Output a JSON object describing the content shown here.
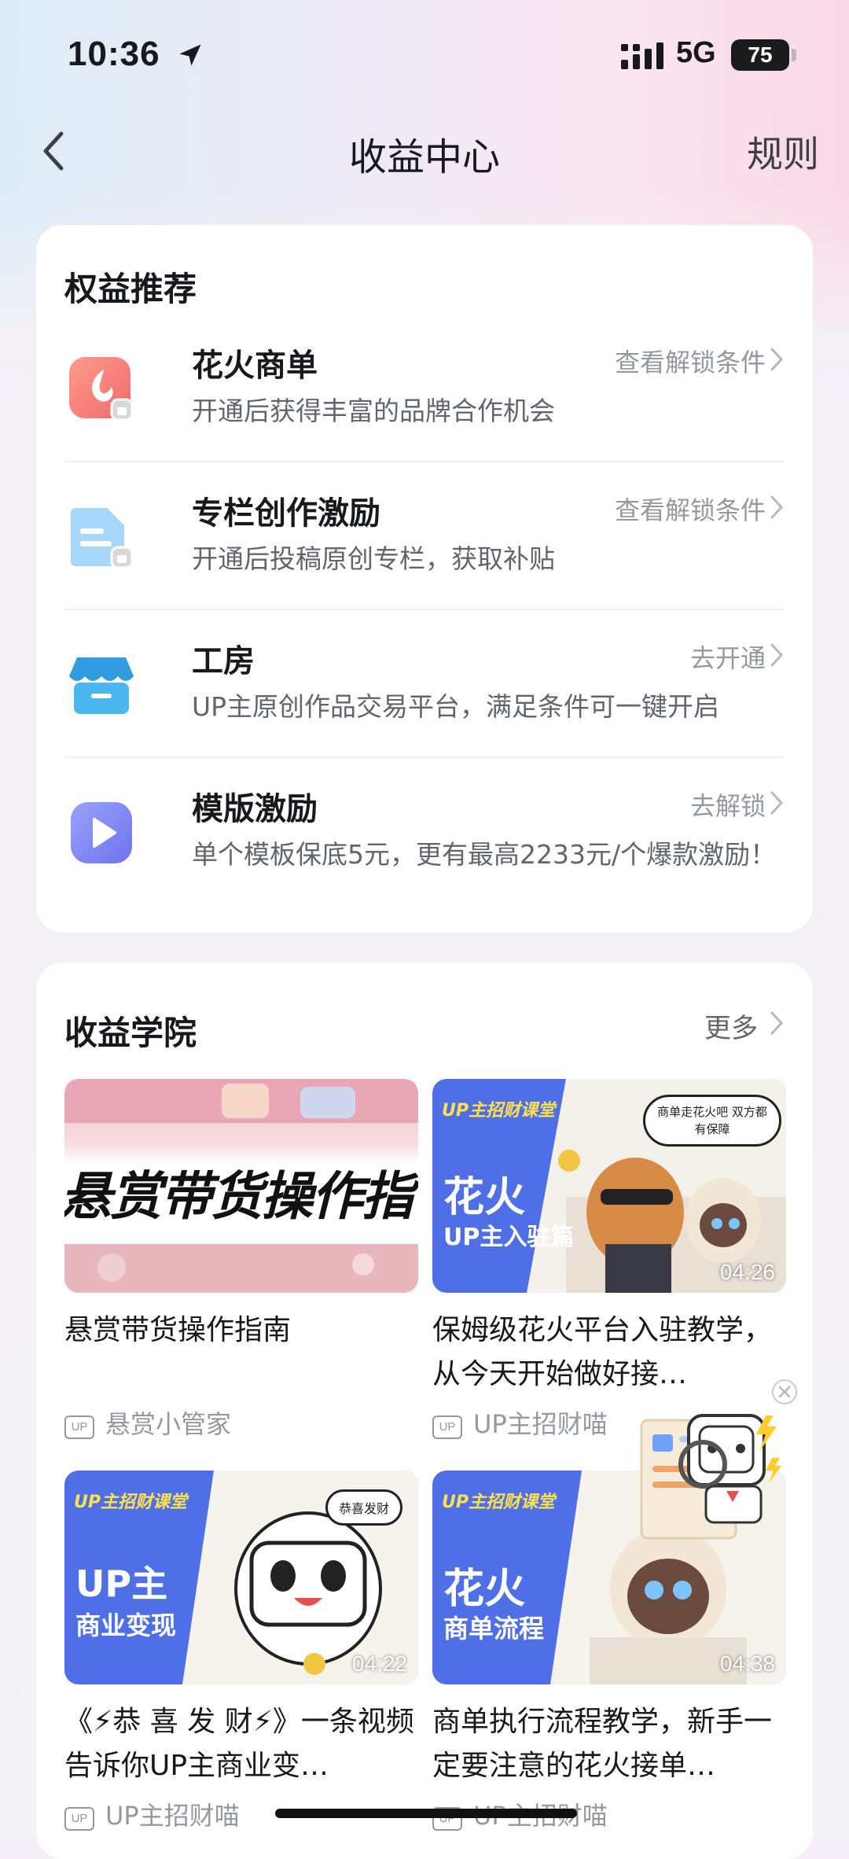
{
  "status_bar": {
    "time": "10:36",
    "network": "5G",
    "battery": "75"
  },
  "nav": {
    "title": "收益中心",
    "rules": "规则"
  },
  "benefits": {
    "title": "权益推荐",
    "items": [
      {
        "name": "花火商单",
        "desc": "开通后获得丰富的品牌合作机会",
        "action": "查看解锁条件",
        "icon": "spark-icon",
        "color": "#f26f6f"
      },
      {
        "name": "专栏创作激励",
        "desc": "开通后投稿原创专栏，获取补贴",
        "action": "查看解锁条件",
        "icon": "document-icon",
        "color": "#8cc8f2"
      },
      {
        "name": "工房",
        "desc": "UP主原创作品交易平台，满足条件可一键开启",
        "action": "去开通",
        "icon": "shop-icon",
        "color": "#3aa9e6"
      },
      {
        "name": "模版激励",
        "desc": "单个模板保底5元，更有最高2233元/个爆款激励！",
        "action": "去解锁",
        "icon": "play-icon",
        "color": "#7b83f0"
      }
    ]
  },
  "academy": {
    "title": "收益学院",
    "more": "更多",
    "videos": [
      {
        "title": "悬赏带货操作指南",
        "author": "悬赏小管家",
        "duration": "",
        "thumb_text": "悬赏带货操作指"
      },
      {
        "title": "保姆级花火平台入驻教学，从今天开始做好接…",
        "author": "UP主招财喵",
        "duration": "04:26",
        "thumb_brand": "UP主招财课堂",
        "thumb_big": "花火",
        "thumb_sub": "UP主入驻篇",
        "bubble": "商单走花火吧 双方都有保障"
      },
      {
        "title": "《⚡恭 喜 发 财⚡》一条视频告诉你UP主商业变…",
        "author": "UP主招财喵",
        "duration": "04:22",
        "thumb_brand": "UP主招财课堂",
        "thumb_big": "UP主",
        "thumb_sub": "商业变现",
        "bubble": "恭喜发财"
      },
      {
        "title": "商单执行流程教学，新手一定要注意的花火接单…",
        "author": "UP主招财喵",
        "duration": "04:38",
        "thumb_brand": "UP主招财课堂",
        "thumb_big": "花火",
        "thumb_sub": "商单流程"
      }
    ]
  },
  "up_tag": "UP"
}
